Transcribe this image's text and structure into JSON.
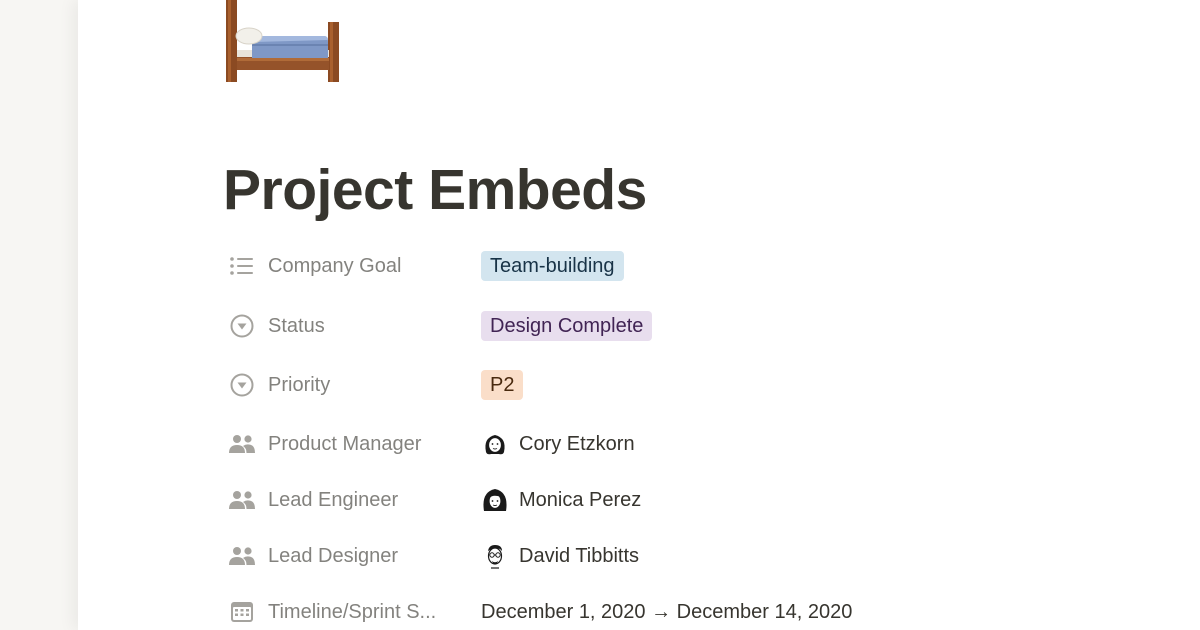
{
  "page": {
    "icon": "bed-emoji",
    "title": "Project Embeds"
  },
  "properties": [
    {
      "label": "Company Goal",
      "icon": "list-icon",
      "type": "tag",
      "value": "Team-building",
      "tag_bg": "#d3e5ef",
      "tag_color": "#183347"
    },
    {
      "label": "Status",
      "icon": "select-icon",
      "type": "tag",
      "value": "Design Complete",
      "tag_bg": "#e8deee",
      "tag_color": "#412454"
    },
    {
      "label": "Priority",
      "icon": "select-icon",
      "type": "tag",
      "value": "P2",
      "tag_bg": "#fadec9",
      "tag_color": "#49290e"
    },
    {
      "label": "Product Manager",
      "icon": "person-icon",
      "type": "person",
      "value": "Cory Etzkorn"
    },
    {
      "label": "Lead Engineer",
      "icon": "person-icon",
      "type": "person",
      "value": "Monica Perez"
    },
    {
      "label": "Lead Designer",
      "icon": "person-icon",
      "type": "person",
      "value": "David Tibbitts"
    },
    {
      "label": "Timeline/Sprint S...",
      "icon": "calendar-icon",
      "type": "date",
      "value": "December 1, 2020 → December 14, 2020"
    }
  ]
}
